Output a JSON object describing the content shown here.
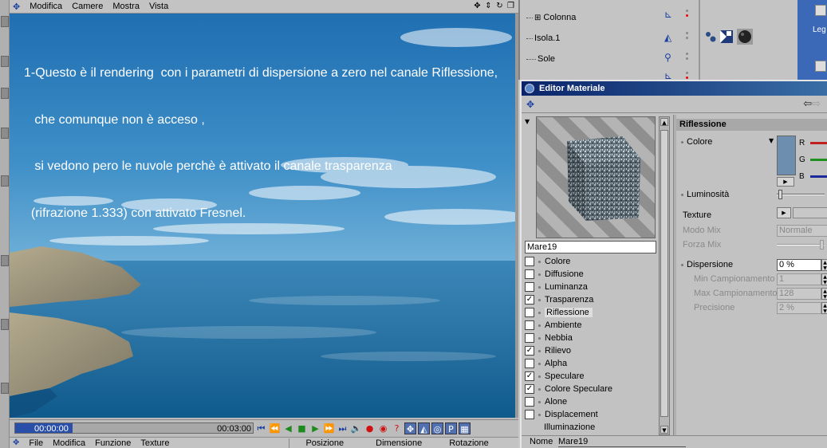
{
  "viewport": {
    "menu": [
      "Modifica",
      "Camere",
      "Mostra",
      "Vista"
    ],
    "nav_glyphs": [
      "✥",
      "⇕",
      "↻",
      "❐"
    ],
    "overlay_lines": [
      "1-Questo è il rendering  con i parametri di dispersione a zero nel canale Riflessione,",
      "   che comunque non è acceso ,",
      "   si vedono pero le nuvole perchè è attivato il canale trasparenza",
      "  (rifrazione 1.333) con attivato Fresnel."
    ],
    "time_start": "00:00:00",
    "time_end": "00:03:00",
    "time_progress": 0.24
  },
  "bottom_menu": {
    "left": [
      "File",
      "Modifica",
      "Funzione",
      "Texture"
    ],
    "right": [
      "Posizione",
      "Dimensione",
      "Rotazione"
    ]
  },
  "object_manager": {
    "objects": [
      {
        "label": "Colonna",
        "prefix": "⊞"
      },
      {
        "label": "Isola.1",
        "prefix": ""
      },
      {
        "label": "Sole",
        "prefix": ""
      }
    ]
  },
  "right_edge": {
    "label": "Leg"
  },
  "material_editor": {
    "title": "Editor Materiale",
    "material_name": "Mare19",
    "channels": [
      {
        "label": "Colore",
        "checked": false
      },
      {
        "label": "Diffusione",
        "checked": false
      },
      {
        "label": "Luminanza",
        "checked": false
      },
      {
        "label": "Trasparenza",
        "checked": true
      },
      {
        "label": "Riflessione",
        "checked": false,
        "selected": true
      },
      {
        "label": "Ambiente",
        "checked": false
      },
      {
        "label": "Nebbia",
        "checked": false
      },
      {
        "label": "Rilievo",
        "checked": true
      },
      {
        "label": "Alpha",
        "checked": false
      },
      {
        "label": "Speculare",
        "checked": true
      },
      {
        "label": "Colore Speculare",
        "checked": true
      },
      {
        "label": "Alone",
        "checked": false
      },
      {
        "label": "Displacement",
        "checked": false
      },
      {
        "label": "Illuminazione",
        "checkbox": false
      }
    ],
    "section_title": "Riflessione",
    "props": {
      "colore": "Colore",
      "luminosita": "Luminosità",
      "texture": "Texture",
      "modo_mix": "Modo Mix",
      "modo_mix_value": "Normale",
      "forza_mix": "Forza Mix",
      "dispersione": "Dispersione",
      "dispersione_value": "0 %",
      "min_camp": "Min Campionamento",
      "min_camp_value": "1",
      "max_camp": "Max Campionamento",
      "max_camp_value": "128",
      "precisione": "Precisione",
      "precisione_value": "2 %"
    },
    "rgb_labels": [
      "R",
      "G",
      "B"
    ],
    "swatch_color": "#6e8eaf",
    "bottom_label": "Nome",
    "bottom_value": "Mare19"
  }
}
